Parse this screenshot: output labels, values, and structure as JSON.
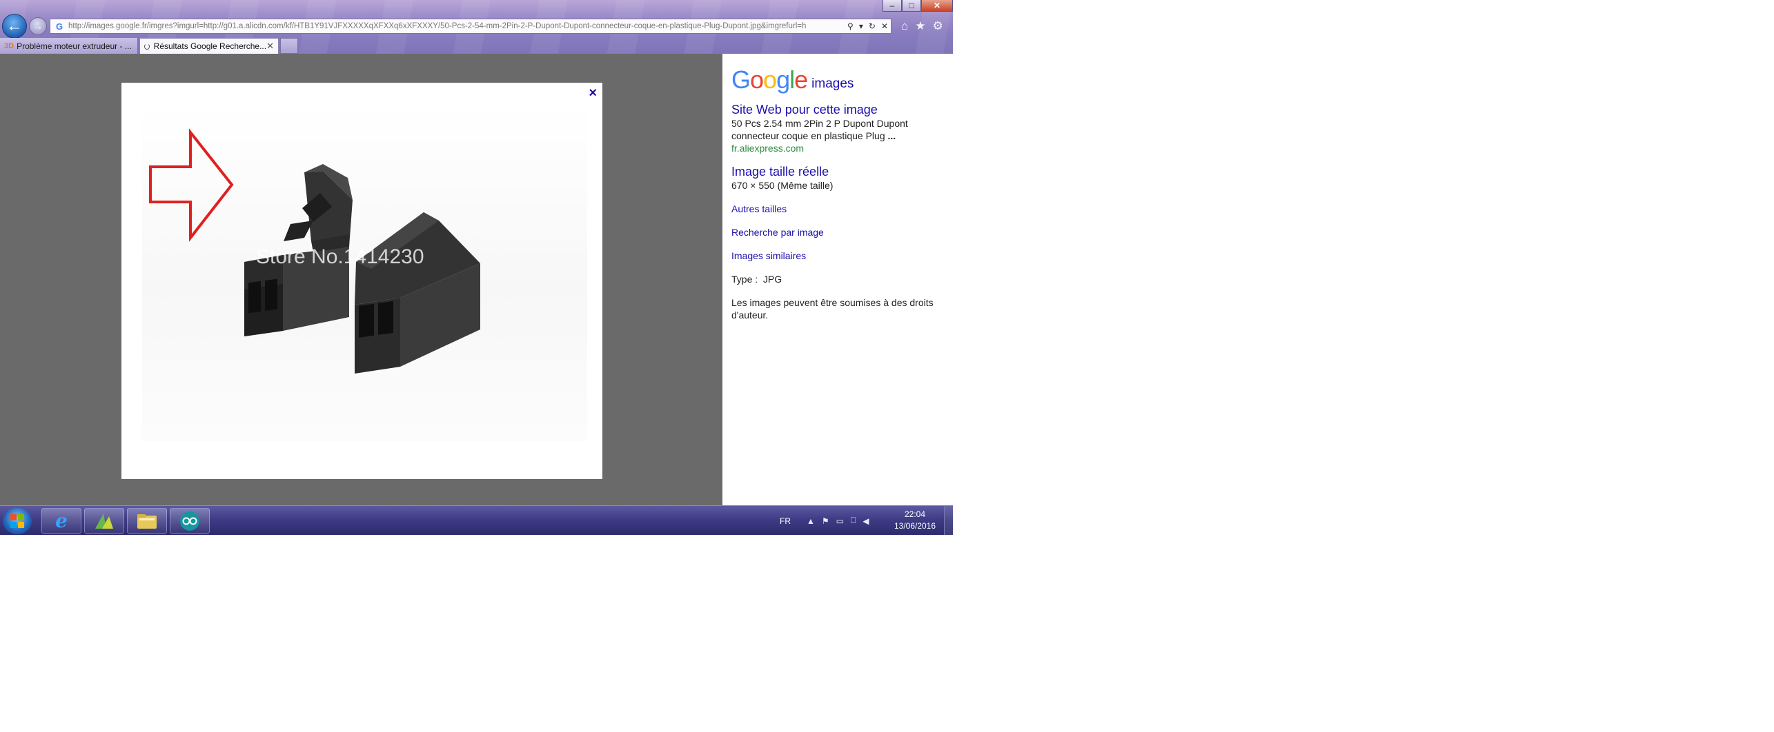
{
  "browser": {
    "window_controls": {
      "minimize": "–",
      "maximize": "□",
      "close": "✕"
    },
    "address_bar": {
      "url": "http://images.google.fr/imgres?imgurl=http://g01.a.alicdn.com/kf/HTB1Y91VJFXXXXXqXFXXq6xXFXXXY/50-Pcs-2-54-mm-2Pin-2-P-Dupont-Dupont-connecteur-coque-en-plastique-Plug-Dupont.jpg&imgrefurl=h",
      "favicon": "G"
    },
    "tabs": [
      {
        "label": "Problème moteur extrudeur - ...",
        "icon": "3D"
      },
      {
        "label": "Résultats Google Recherche...",
        "close": "✕"
      }
    ]
  },
  "lightbox": {
    "close": "×",
    "watermark": "Store No.1414230"
  },
  "side_panel": {
    "logo": {
      "letters": [
        "G",
        "o",
        "o",
        "g",
        "l",
        "e"
      ],
      "colors": [
        "#4285f4",
        "#ea4335",
        "#fbbc05",
        "#4285f4",
        "#34a853",
        "#ea4335"
      ],
      "suffix": "images"
    },
    "site_heading": "Site Web pour cette image",
    "site_desc": "50 Pcs 2.54 mm 2Pin 2 P Dupont Dupont connecteur coque en plastique Plug",
    "site_desc_ellipsis": "...",
    "site_url": "fr.aliexpress.com",
    "full_size_heading": "Image taille réelle",
    "full_size_dims": "670 × 550 (Même taille)",
    "links": [
      "Autres tailles",
      "Recherche par image",
      "Images similaires"
    ],
    "type_label": "Type :",
    "type_value": "JPG",
    "rights_notice": "Les images peuvent être soumises à des droits d'auteur."
  },
  "taskbar": {
    "language": "FR",
    "time": "22:04",
    "date": "13/06/2016"
  }
}
